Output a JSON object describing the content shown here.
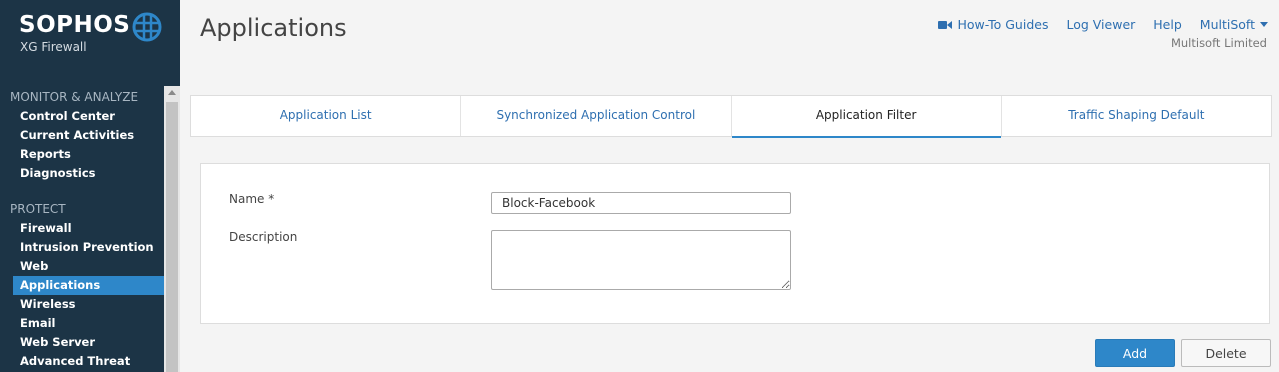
{
  "brand": {
    "name": "SOPHOS",
    "product": "XG Firewall",
    "logo_icon": "globe-logo-icon"
  },
  "sidebar": {
    "sections": [
      {
        "title": "MONITOR & ANALYZE",
        "items": [
          "Control Center",
          "Current Activities",
          "Reports",
          "Diagnostics"
        ]
      },
      {
        "title": "PROTECT",
        "items": [
          "Firewall",
          "Intrusion Prevention",
          "Web",
          "Applications",
          "Wireless",
          "Email",
          "Web Server",
          "Advanced Threat"
        ]
      }
    ],
    "active_item": "Applications"
  },
  "header": {
    "title": "Applications",
    "links": {
      "howto": "How-To Guides",
      "logviewer": "Log Viewer",
      "help": "Help",
      "user": "MultiSoft"
    },
    "org": "Multisoft Limited"
  },
  "tabs": [
    {
      "label": "Application List",
      "active": false
    },
    {
      "label": "Synchronized Application Control",
      "active": false
    },
    {
      "label": "Application Filter",
      "active": true
    },
    {
      "label": "Traffic Shaping Default",
      "active": false
    }
  ],
  "form": {
    "name_label": "Name *",
    "name_value": "Block-Facebook",
    "description_label": "Description",
    "description_value": ""
  },
  "buttons": {
    "add": "Add",
    "delete": "Delete"
  },
  "colors": {
    "sidebar_bg": "#1c3446",
    "accent": "#2e87c9",
    "link": "#2e6fb0"
  }
}
